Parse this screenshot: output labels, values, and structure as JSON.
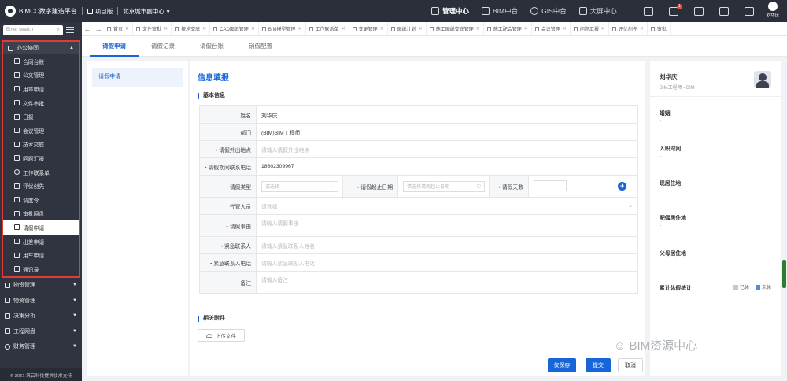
{
  "header": {
    "brand": "BIMCC数字建造平台",
    "project": "项目版",
    "org": "北京城市副中心",
    "nav": [
      "管理中心",
      "BIM中台",
      "GIS中台",
      "大屏中心"
    ],
    "notification_count": "1",
    "user": "刘华庆"
  },
  "sidebar": {
    "search_placeholder": "Enter search",
    "open_group": "办公协同",
    "open_items": [
      "合同台账",
      "公文管理",
      "用章申请",
      "文件审批",
      "日报",
      "会议管理",
      "技术交底",
      "问题汇报",
      "工作联系单",
      "评优创先",
      "调度令",
      "审批网盘",
      "请假申请",
      "出差申请",
      "用车申请",
      "通讯录"
    ],
    "active_item": "请假申请",
    "groups": [
      "物资管理",
      "物资管理",
      "决策分析",
      "工程网盘",
      "财务管理"
    ],
    "footer": "© 2021 筑云科技提供技术支持"
  },
  "tabs": [
    "首页",
    "文件审批",
    "技术交底",
    "CAD图纸管理",
    "BIM模型管理",
    "工作联系单",
    "变更管理",
    "图纸计划",
    "施工图纸交底管理",
    "施工配合管理",
    "会议管理",
    "问题汇报",
    "评优创先",
    "审批"
  ],
  "subtabs": [
    "请假申请",
    "请假记录",
    "请假台账",
    "销假配置"
  ],
  "left_panel": {
    "item": "请假申请"
  },
  "form": {
    "title": "信息填报",
    "basic_section": "基本信息",
    "name_label": "姓名",
    "name_value": "刘华庆",
    "dept_label": "部门",
    "dept_value": "(BIM)BIM工程师",
    "place_label": "请假外出地点",
    "place_placeholder": "请输入请假外出地点",
    "phone_label": "请假期间联系电话",
    "phone_value": "18602309967",
    "type_label": "请假类型",
    "type_placeholder": "请选择",
    "dates_label": "请假起止日期",
    "dates_placeholder": "请选择请假起止日期",
    "days_label": "请假天数",
    "agent_label": "代管人员",
    "agent_placeholder": "请选择",
    "reason_label": "请假事由",
    "reason_placeholder": "请输入请假事由",
    "contact_label": "紧急联系人",
    "contact_placeholder": "请输入紧急联系人姓名",
    "contact_phone_label": "紧急联系人电话",
    "contact_phone_placeholder": "请输入紧急联系人电话",
    "note_label": "备注",
    "note_placeholder": "请输入备注",
    "attach_section": "相关附件",
    "upload_label": "上传文件",
    "save_draft": "仅保存",
    "submit": "提交",
    "cancel": "取消"
  },
  "right_panel": {
    "name": "刘华庆",
    "role": "BIM工程师 - BIM",
    "fields": [
      {
        "label": "婚姻",
        "value": "-"
      },
      {
        "label": "入职时间",
        "value": "-"
      },
      {
        "label": "现居住地",
        "value": "-"
      },
      {
        "label": "配偶居住地",
        "value": "-"
      },
      {
        "label": "父母居住地",
        "value": "-"
      }
    ],
    "leave_stats_label": "累计休假统计",
    "legend_used": "已休",
    "legend_unused": "未休"
  },
  "watermark": "BIM资源中心",
  "colors": {
    "primary": "#1765d8",
    "sidebar": "#2f3440",
    "topbar": "#2b2f3a",
    "highlight_border": "#e53935"
  }
}
